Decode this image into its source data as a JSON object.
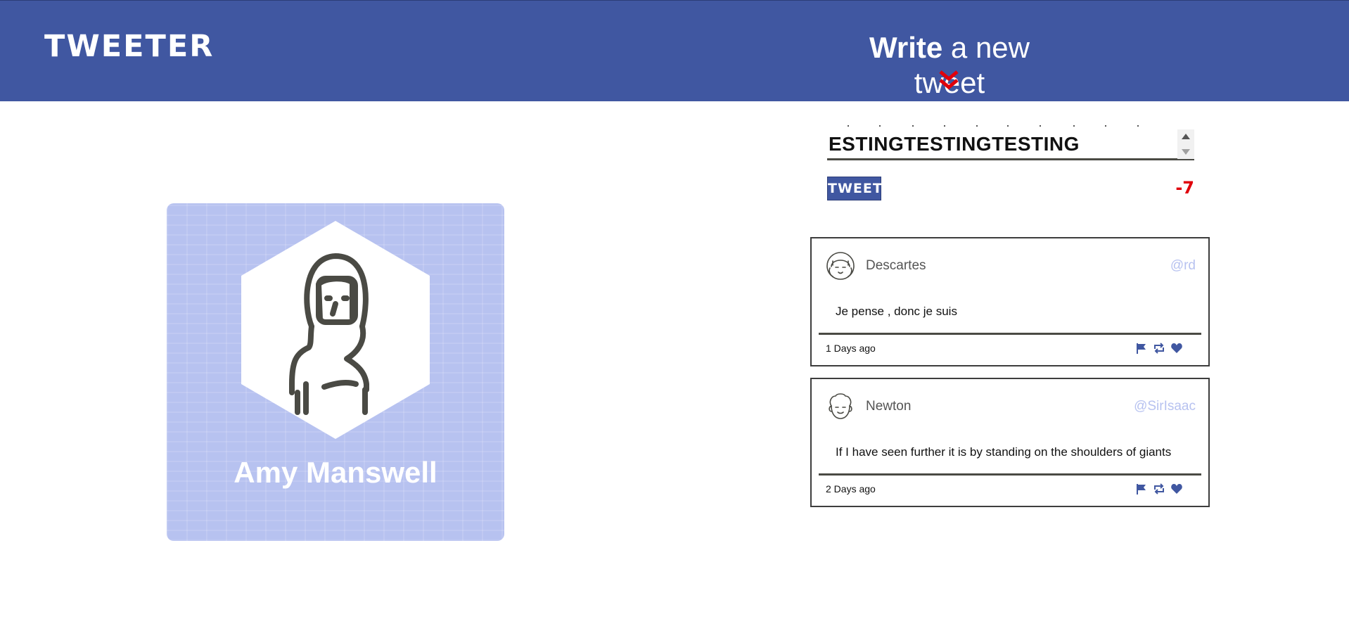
{
  "nav": {
    "logo": "TWEETER",
    "compose_bold": "Write",
    "compose_rest": " a new tweet",
    "chevron_icon": "double-chevron-down-icon",
    "chevron_color": "#e0000b"
  },
  "profile": {
    "name": "Amy Manswell",
    "avatar_icon": "woman-avatar-icon",
    "card_color": "#b7c2f0"
  },
  "compose": {
    "text": "ESTINGTESTINGTESTING",
    "button_label": "TWEET",
    "counter": "-7",
    "counter_color": "#e0000b"
  },
  "tweets": [
    {
      "name": "Descartes",
      "handle": "@rd",
      "content": "Je pense , donc je suis",
      "time": "1 Days ago",
      "avatar_icon": "girl-face-icon"
    },
    {
      "name": "Newton",
      "handle": "@SirIsaac",
      "content": "If I have seen further it is by standing on the shoulders of giants",
      "time": "2 Days ago",
      "avatar_icon": "curly-hair-face-icon"
    }
  ],
  "tweet_actions": [
    "flag-icon",
    "retweet-icon",
    "heart-icon"
  ],
  "colors": {
    "primary": "#4057a1",
    "accent": "#b7c2f0"
  }
}
